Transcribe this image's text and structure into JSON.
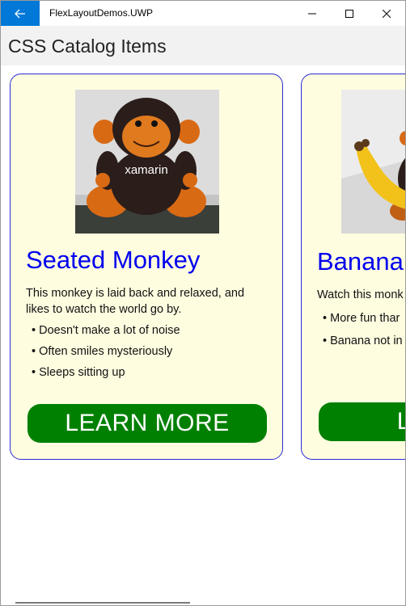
{
  "window": {
    "app_title": "FlexLayoutDemos.UWP",
    "back_icon": "arrow-left-icon",
    "accent_color": "#0078d7"
  },
  "header": {
    "title": "CSS Catalog Items"
  },
  "cards": [
    {
      "title": "Seated Monkey",
      "description": "This monkey is laid back and relaxed, and likes to watch the world go by.",
      "bullets": [
        "Doesn't make a lot of noise",
        "Often smiles mysteriously",
        "Sleeps sitting up"
      ],
      "button_label": "LEARN MORE",
      "image_label": "xamarin"
    },
    {
      "title": "Banana",
      "description": "Watch this monk",
      "bullets": [
        "More fun thar",
        "Banana not in"
      ],
      "button_label": "LEARN"
    }
  ],
  "colors": {
    "card_bg": "#fffde0",
    "card_border": "#2a2ad4",
    "title": "#0000ee",
    "button": "#008000"
  }
}
